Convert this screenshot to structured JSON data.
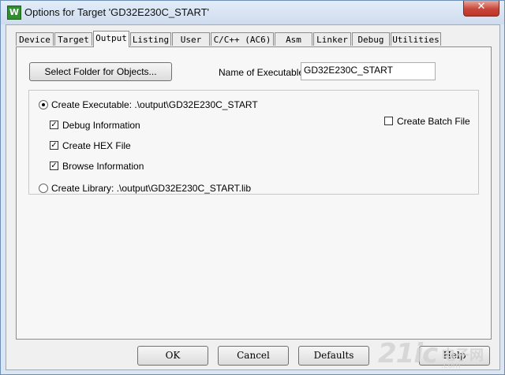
{
  "window": {
    "title": "Options for Target 'GD32E230C_START'",
    "icon_letter": "W",
    "close_glyph": "✕"
  },
  "tabs": [
    {
      "label": "Device"
    },
    {
      "label": "Target"
    },
    {
      "label": "Output",
      "active": true
    },
    {
      "label": "Listing"
    },
    {
      "label": "User"
    },
    {
      "label": "C/C++ (AC6)"
    },
    {
      "label": "Asm"
    },
    {
      "label": "Linker"
    },
    {
      "label": "Debug"
    },
    {
      "label": "Utilities"
    }
  ],
  "output": {
    "select_folder_label": "Select Folder for Objects...",
    "name_of_executable_label": "Name of Executable:",
    "name_of_executable_value": "GD32E230C_START",
    "create_executable_label": "Create Executable:  .\\output\\GD32E230C_START",
    "create_executable_selected": true,
    "debug_info_label": "Debug Information",
    "debug_info_checked": true,
    "create_hex_label": "Create HEX File",
    "create_hex_checked": true,
    "browse_info_label": "Browse Information",
    "browse_info_checked": true,
    "create_batch_label": "Create Batch File",
    "create_batch_checked": false,
    "create_library_label": "Create Library:  .\\output\\GD32E230C_START.lib",
    "create_library_selected": false
  },
  "buttons": {
    "ok": "OK",
    "cancel": "Cancel",
    "defaults": "Defaults",
    "help": "Help"
  },
  "check_glyph": "✓",
  "watermark": {
    "main": "21ic",
    "side": "电子网",
    "dot": ".com"
  }
}
